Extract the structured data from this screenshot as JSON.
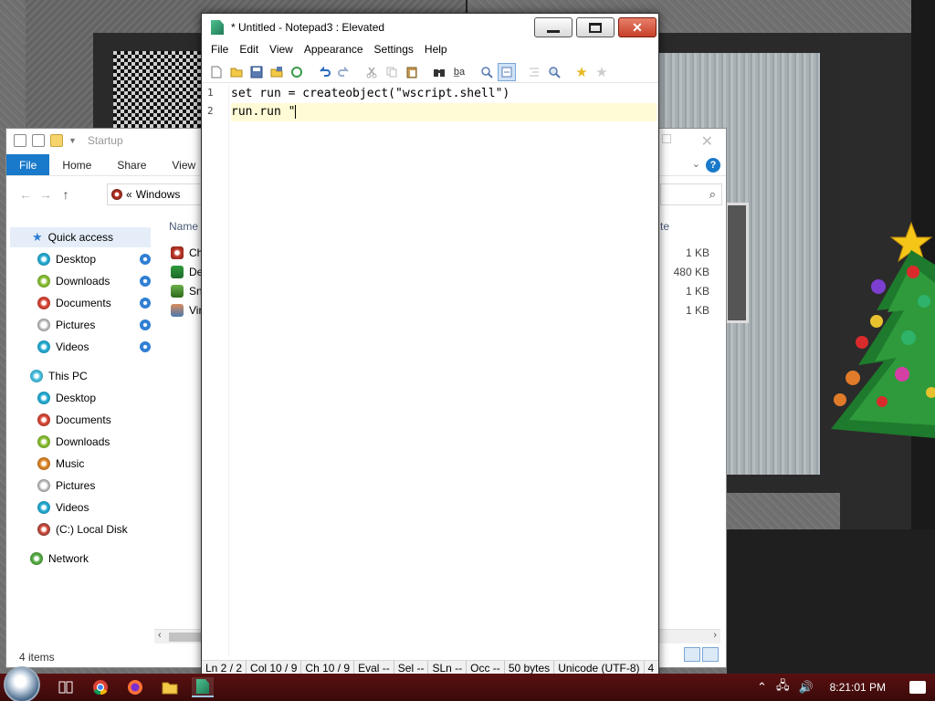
{
  "notepad": {
    "title": "* Untitled - Notepad3 : Elevated",
    "window_controls": {
      "close_glyph": "✕"
    },
    "menu": [
      "File",
      "Edit",
      "View",
      "Appearance",
      "Settings",
      "Help"
    ],
    "toolbar_icons": [
      "new-file-icon",
      "open-folder-icon",
      "save-icon",
      "save-as-icon",
      "revert-icon",
      "undo-icon",
      "redo-icon",
      "cut-icon",
      "copy-icon",
      "paste-icon",
      "find-icon",
      "replace-icon",
      "zoom-icon",
      "word-wrap-icon",
      "indent-icon",
      "zoom-in-icon",
      "favorite-icon",
      "add-favorite-icon"
    ],
    "lines": [
      {
        "number": "1",
        "text": "set run = createobject(\"wscript.shell\")"
      },
      {
        "number": "2",
        "text": "run.run \""
      }
    ],
    "status": {
      "ln": "Ln  2 / 2",
      "col": "Col  10 / 9",
      "ch": "Ch  10 / 9",
      "eval": "Eval  --",
      "sel": "Sel  --",
      "sln": "SLn  --",
      "occ": "Occ  --",
      "size": "50 bytes",
      "encoding": "Unicode (UTF-8)",
      "tail": "4"
    }
  },
  "explorer": {
    "title": "Startup",
    "ribbon_tabs": [
      "File",
      "Home",
      "Share",
      "View"
    ],
    "address": {
      "prefix": "«",
      "path": "Windows"
    },
    "column_name": "Name",
    "column_size": "te",
    "nav": {
      "quick_access": "Quick access",
      "quick_items": [
        "Desktop",
        "Downloads",
        "Documents",
        "Pictures",
        "Videos"
      ],
      "this_pc": "This PC",
      "pc_items": [
        "Desktop",
        "Documents",
        "Downloads",
        "Music",
        "Pictures",
        "Videos",
        "(C:) Local Disk"
      ],
      "network": "Network"
    },
    "files": [
      {
        "name": "Ch",
        "size": "1 KB"
      },
      {
        "name": "De",
        "size": "480 KB"
      },
      {
        "name": "Sn",
        "size": "1 KB"
      },
      {
        "name": "Vir",
        "size": "1 KB"
      }
    ],
    "status": "4 items"
  },
  "taskbar": {
    "clock": "8:21:01 PM",
    "tray_icons": [
      "chevron-up-icon",
      "network-icon",
      "volume-icon"
    ]
  },
  "colors": {
    "accent": "#1979ca",
    "close_button": "#c7402a",
    "current_line": "#fffbd6",
    "taskbar": "#4a0d0d"
  }
}
